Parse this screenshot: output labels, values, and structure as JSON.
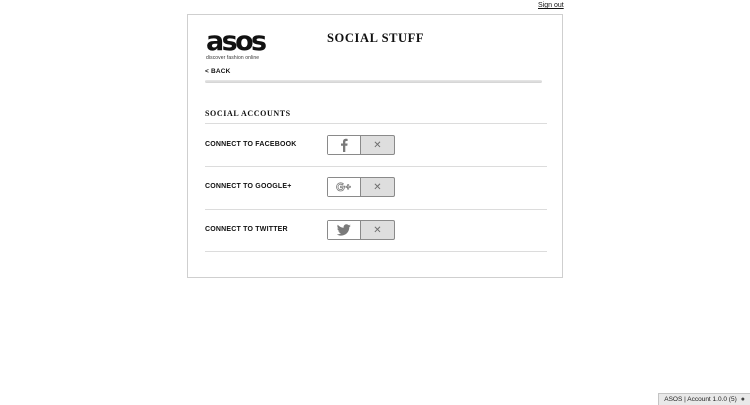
{
  "header": {
    "signout_label": "Sign out"
  },
  "brand": {
    "logo_text": "asos",
    "tagline": "discover fashion online"
  },
  "page": {
    "title": "SOCIAL STUFF",
    "back_label": "< BACK"
  },
  "section": {
    "title": "SOCIAL ACCOUNTS"
  },
  "rows": [
    {
      "label": "CONNECT TO FACEBOOK",
      "icon": "facebook-icon",
      "state_symbol": "✕"
    },
    {
      "label": "CONNECT TO GOOGLE+",
      "icon": "google-plus-icon",
      "state_symbol": "✕"
    },
    {
      "label": "CONNECT TO TWITTER",
      "icon": "twitter-icon",
      "state_symbol": "✕"
    }
  ],
  "statusbar": {
    "text": "ASOS | Account 1.0.0 (5)",
    "indicator": "●"
  }
}
